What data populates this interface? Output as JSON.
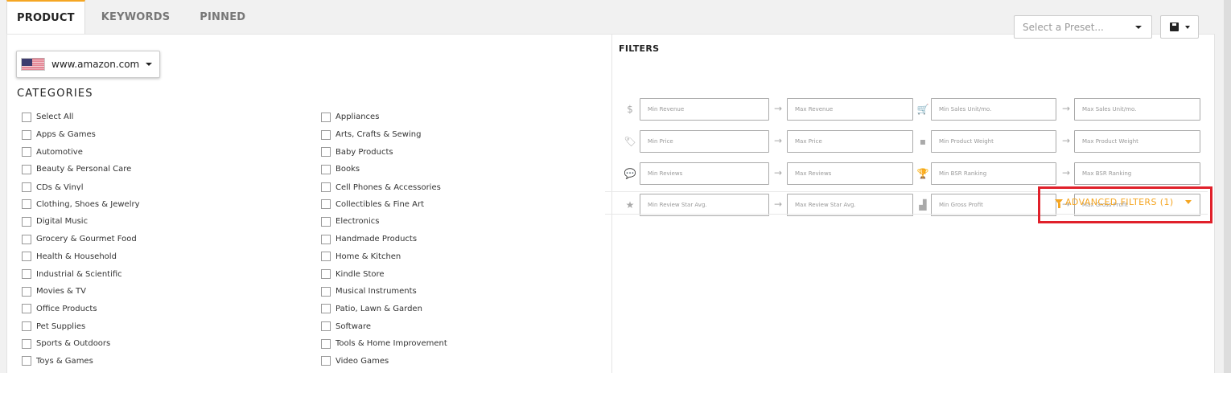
{
  "tabs": [
    {
      "label": "PRODUCT",
      "active": true
    },
    {
      "label": "KEYWORDS",
      "active": false
    },
    {
      "label": "PINNED",
      "active": false
    }
  ],
  "marketplace": {
    "label": "www.amazon.com",
    "flag_icon": "us-flag-icon"
  },
  "categories": {
    "title": "CATEGORIES",
    "col1": [
      "Select All",
      "Apps & Games",
      "Automotive",
      "Beauty & Personal Care",
      "CDs & Vinyl",
      "Clothing, Shoes & Jewelry",
      "Digital Music",
      "Grocery & Gourmet Food",
      "Health & Household",
      "Industrial & Scientific",
      "Movies & TV",
      "Office Products",
      "Pet Supplies",
      "Sports & Outdoors",
      "Toys & Games"
    ],
    "col2": [
      "Appliances",
      "Arts, Crafts & Sewing",
      "Baby Products",
      "Books",
      "Cell Phones & Accessories",
      "Collectibles & Fine Art",
      "Electronics",
      "Handmade Products",
      "Home & Kitchen",
      "Kindle Store",
      "Musical Instruments",
      "Patio, Lawn & Garden",
      "Software",
      "Tools & Home Improvement",
      "Video Games"
    ]
  },
  "preset": {
    "placeholder": "Select a Preset..."
  },
  "filters": {
    "title": "FILTERS",
    "arrow": "→",
    "rows": [
      {
        "left_icon": "dollar-icon",
        "left_glyph": "$",
        "min1": "Min Revenue",
        "max1": "Max Revenue",
        "right_icon": "cart-icon",
        "right_glyph": "🛒",
        "min2": "Min Sales Unit/mo.",
        "max2": "Max Sales Unit/mo."
      },
      {
        "left_icon": "price-tag-icon",
        "left_glyph": "🏷",
        "min1": "Min Price",
        "max1": "Max Price",
        "right_icon": "weight-icon",
        "right_glyph": "▪",
        "min2": "Min Product Weight",
        "max2": "Max Product Weight"
      },
      {
        "left_icon": "comments-icon",
        "left_glyph": "💬",
        "min1": "Min Reviews",
        "max1": "Max Reviews",
        "right_icon": "trophy-icon",
        "right_glyph": "🏆",
        "min2": "Min BSR Ranking",
        "max2": "Max BSR Ranking"
      },
      {
        "left_icon": "star-icon",
        "left_glyph": "★",
        "min1": "Min Review Star Avg.",
        "max1": "Max Review Star Avg.",
        "right_icon": "bar-chart-icon",
        "right_glyph": "▟",
        "min2": "Min Gross Profit",
        "max2": "Max Gross Profit"
      }
    ]
  },
  "advanced_filters": {
    "label": "ADVANCED FILTERS (1)"
  },
  "colors": {
    "accent": "#f5a623",
    "highlight": "#e0202a"
  }
}
